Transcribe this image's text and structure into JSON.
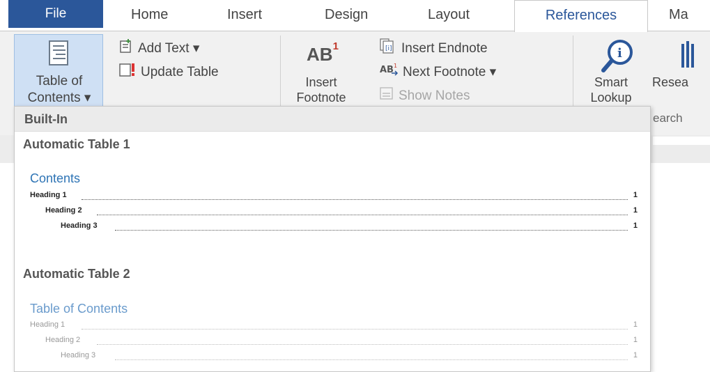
{
  "tabs": {
    "file": "File",
    "home": "Home",
    "insert": "Insert",
    "design": "Design",
    "layout": "Layout",
    "references": "References",
    "mailings": "Ma"
  },
  "ribbon": {
    "toc_button": {
      "line1": "Table of",
      "line2": "Contents ▾"
    },
    "add_text": "Add Text ▾",
    "update_table": "Update Table",
    "insert_footnote": {
      "glyph": "AB",
      "sup": "1",
      "line1": "Insert",
      "line2": "Footnote"
    },
    "insert_endnote": "Insert Endnote",
    "next_footnote": "Next Footnote ▾",
    "show_notes": "Show Notes",
    "smart_lookup": {
      "line1": "Smart",
      "line2": "Lookup"
    },
    "research": "Resea",
    "group_research_partial": "earch"
  },
  "gallery": {
    "header": "Built-In",
    "entries": [
      {
        "title": "Automatic Table 1",
        "contents_title": "Contents",
        "lines": [
          {
            "text": "Heading 1",
            "page": "1"
          },
          {
            "text": "Heading 2",
            "page": "1"
          },
          {
            "text": "Heading 3",
            "page": "1"
          }
        ]
      },
      {
        "title": "Automatic Table 2",
        "contents_title": "Table of Contents",
        "lines": [
          {
            "text": "Heading 1",
            "page": "1"
          },
          {
            "text": "Heading 2",
            "page": "1"
          },
          {
            "text": "Heading 3",
            "page": "1"
          }
        ]
      }
    ]
  },
  "colors": {
    "file_tab": "#2b579a",
    "accent": "#2b579a",
    "toc_heading": "#2e74b5",
    "selected_button": "#cfe0f4"
  }
}
